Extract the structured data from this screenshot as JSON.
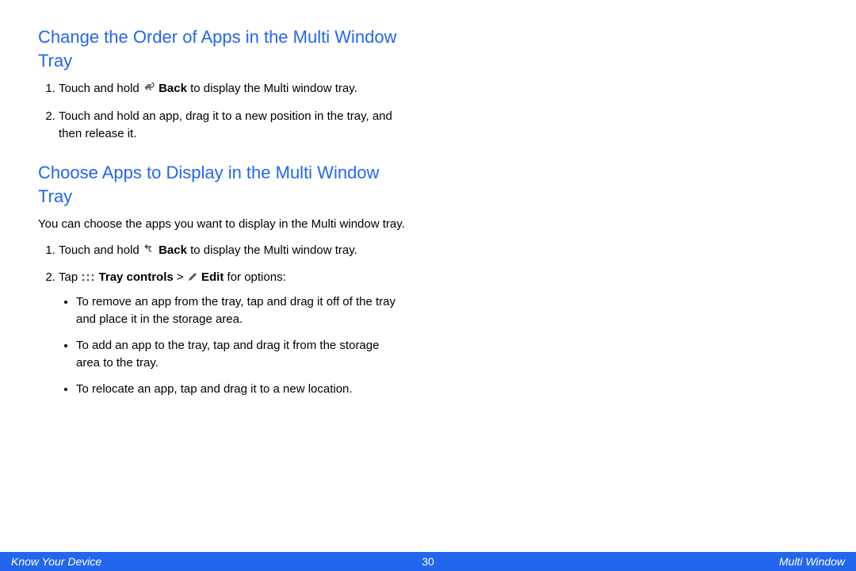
{
  "section1": {
    "heading": "Change the Order of Apps in the Multi Window Tray",
    "steps": [
      {
        "pre": "Touch and hold ",
        "icon": "back-icon",
        "bold": "Back",
        "post": " to display the Multi window tray."
      },
      {
        "text": "Touch and hold an app, drag it to a new position in the tray, and then release it."
      }
    ]
  },
  "section2": {
    "heading": "Choose Apps to Display in the Multi Window Tray",
    "intro": "You can choose the apps you want to display in the Multi window tray.",
    "step1": {
      "pre": "Touch and hold ",
      "icon": "back-icon",
      "bold": "Back",
      "post": " to display the Multi window tray."
    },
    "step2": {
      "pre": "Tap ",
      "icon1": "dots-icon",
      "bold1": "Tray controls",
      "sep": " > ",
      "icon2": "pencil-icon",
      "bold2": "Edit",
      "post": " for options:"
    },
    "bullets": [
      "To remove an app from the tray, tap and drag it off of the tray and place it in the storage area.",
      "To add an app to the tray, tap and drag it from the storage area to the tray.",
      "To relocate an app, tap and drag it to a new location."
    ]
  },
  "footer": {
    "left": "Know Your Device",
    "page": "30",
    "right": "Multi Window"
  }
}
